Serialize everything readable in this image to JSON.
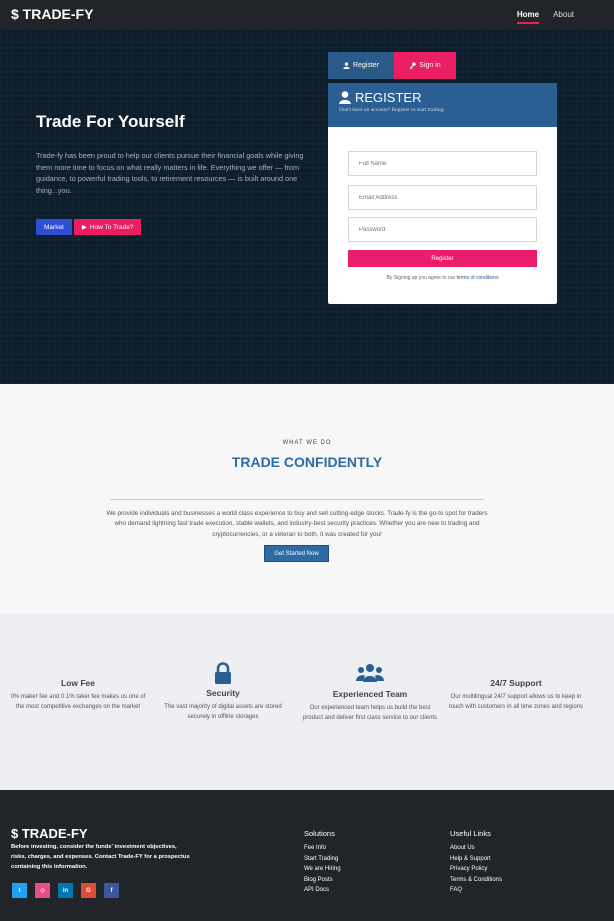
{
  "nav": {
    "logo": "$ TRADE-FY",
    "links": [
      {
        "label": "Home",
        "active": true
      },
      {
        "label": "About",
        "active": false
      }
    ]
  },
  "hero": {
    "title": "Trade For Yourself",
    "text": "Trade-fy has been proud to help our clients pursue their financial goals while giving them more time to focus on what really matters in life. Everything we offer — from guidance, to powerful trading tools, to retirement resources — is built around one thing...you.",
    "market_label": "Market",
    "how_label": "How To Trade?"
  },
  "auth": {
    "tab_register": "Register",
    "tab_signin": "Sign in",
    "title": "REGISTER",
    "subtitle": "Don't have an account? Register to start trading.",
    "fields": {
      "full_name": "Full Name",
      "email": "Email Address",
      "password": "Password"
    },
    "submit_label": "Register",
    "terms_prefix": "By Signing up you agree to our ",
    "terms_link": "terms of conditions"
  },
  "what": {
    "eyebrow": "WHAT WE DO",
    "title": "TRADE CONFIDENTLY",
    "text": "We provide individuals and businesses a world class experience to buy and sell cutting-edge stocks. Trade-fy is the go-to spot for traders who demand lightning fast trade execution, stable wallets, and industry-best security practices. Whether you are new to trading and cryptocurrencies, or a veteran to both, it was created for you!",
    "button": "Get Started Now"
  },
  "features": [
    {
      "title": "Low Fee",
      "text": "0% maker fee and 0.1% taker fee makes us one of the most competitive exchanges on the market",
      "icon": "none"
    },
    {
      "title": "Security",
      "text": "The vast majority of digital assets are stored securely in offline storages",
      "icon": "lock-icon"
    },
    {
      "title": "Experienced Team",
      "text": "Our experienced team helps us build the best product and deliver first class service to our clients",
      "icon": "users-icon"
    },
    {
      "title": "24/7 Support",
      "text": "Our multilingual 24/7 support allows us to keep in touch with customers in all time zones and regions",
      "icon": "none"
    }
  ],
  "footer": {
    "logo": "$ TRADE-FY",
    "text": "Before investing, consider the funds' investment objectives, risks, charges, and expenses. Contact Trade-FY for a prospectus containing this information.",
    "socials": [
      {
        "name": "twitter",
        "glyph": "t",
        "color": "#1da1f2"
      },
      {
        "name": "dribbble",
        "glyph": "◎",
        "color": "#ea4c89"
      },
      {
        "name": "linkedin",
        "glyph": "in",
        "color": "#0077b5"
      },
      {
        "name": "google",
        "glyph": "G",
        "color": "#dd4b39"
      },
      {
        "name": "facebook",
        "glyph": "f",
        "color": "#3b5998"
      }
    ],
    "solutions_title": "Solutions",
    "solutions": [
      "Fee Info",
      "Start Trading",
      "We are Hiring",
      "Blog Posts",
      "API Docs"
    ],
    "useful_title": "Useful Links",
    "useful": [
      "About Us",
      "Help & Support",
      "Privacy Policy",
      "Terms & Conditions",
      "FAQ"
    ]
  },
  "colors": {
    "accent_pink": "#e91e63",
    "brand_blue": "#2b5f94",
    "hero_bg": "#0c1e2c",
    "footer_bg": "#212529"
  }
}
